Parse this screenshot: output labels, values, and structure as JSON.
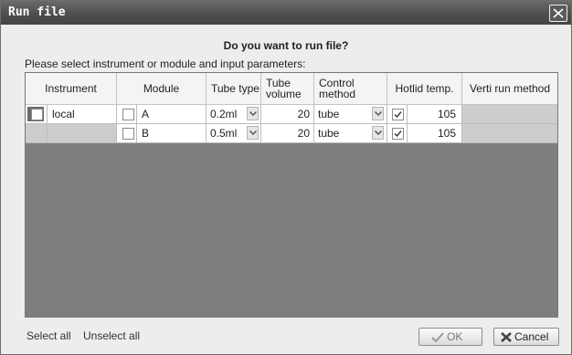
{
  "window": {
    "title": "Run file"
  },
  "dialog": {
    "question": "Do you want to run file?",
    "instruction": "Please select instrument or module and input parameters:"
  },
  "table": {
    "headers": {
      "instrument": "Instrument",
      "module": "Module",
      "tube_type": "Tube type",
      "tube_volume": "Tube volume",
      "control_method": "Control method",
      "hotlid_temp": "Hotlid temp.",
      "verti_run_method": "Verti run method"
    },
    "rows": [
      {
        "instrument": "local",
        "instrument_checked": false,
        "module": "A",
        "module_checked": false,
        "tube_type": "0.2ml",
        "tube_volume": "20",
        "control_method": "tube",
        "hotlid_checked": true,
        "hotlid_temp": "105",
        "verti_run_method": ""
      },
      {
        "instrument": "",
        "instrument_checked": false,
        "module": "B",
        "module_checked": false,
        "tube_type": "0.5ml",
        "tube_volume": "20",
        "control_method": "tube",
        "hotlid_checked": true,
        "hotlid_temp": "105",
        "verti_run_method": ""
      }
    ]
  },
  "footer": {
    "select_all": "Select all",
    "unselect_all": "Unselect all",
    "ok_label": "OK",
    "cancel_label": "Cancel"
  },
  "icons": {
    "close": "close-icon",
    "ok": "checkmark-icon",
    "cancel": "x-icon",
    "dropdown": "chevron-down-icon"
  }
}
